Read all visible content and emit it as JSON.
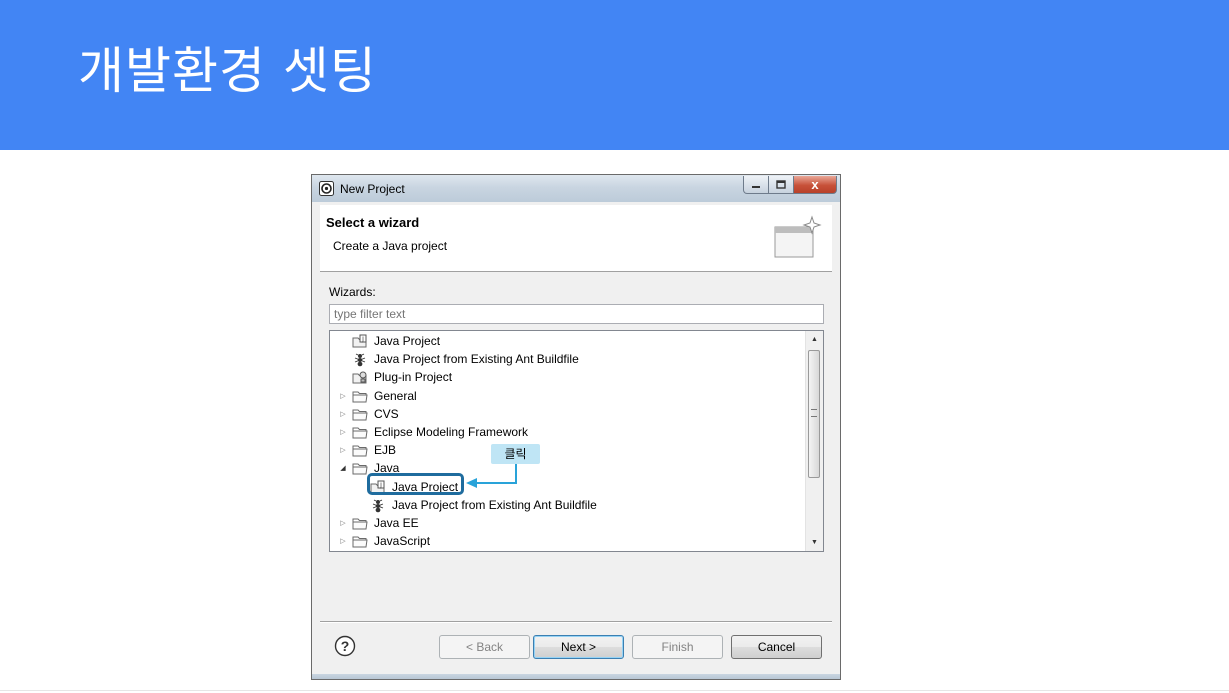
{
  "slide": {
    "title": "개발환경 셋팅"
  },
  "window": {
    "title": "New Project",
    "close_glyph": "x",
    "icons": {
      "app": "eclipse-icon",
      "minimize": "minimize-icon",
      "maximize": "maximize-icon",
      "close": "close-icon"
    }
  },
  "wizard": {
    "title": "Select a wizard",
    "description": "Create a Java project",
    "banner_icon": "new-wizard-icon",
    "wizards_label": "Wizards:",
    "filter_placeholder": "type filter text",
    "tree": [
      {
        "label": "Java Project",
        "icon": "java-project-icon",
        "expanded": null
      },
      {
        "label": "Java Project from Existing Ant Buildfile",
        "icon": "ant-icon",
        "expanded": null
      },
      {
        "label": "Plug-in Project",
        "icon": "plugin-project-icon",
        "expanded": null
      },
      {
        "label": "General",
        "icon": "folder-icon",
        "expanded": false
      },
      {
        "label": "CVS",
        "icon": "folder-icon",
        "expanded": false
      },
      {
        "label": "Eclipse Modeling Framework",
        "icon": "folder-icon",
        "expanded": false
      },
      {
        "label": "EJB",
        "icon": "folder-icon",
        "expanded": false
      },
      {
        "label": "Java",
        "icon": "folder-icon",
        "expanded": true
      },
      {
        "label": "Java Project",
        "icon": "java-project-icon",
        "expanded": null,
        "selected": true
      },
      {
        "label": "Java Project from Existing Ant Buildfile",
        "icon": "ant-icon",
        "expanded": null
      },
      {
        "label": "Java EE",
        "icon": "folder-icon",
        "expanded": false
      },
      {
        "label": "JavaScript",
        "icon": "folder-icon",
        "expanded": false
      }
    ],
    "callout": "클릭",
    "highlight_color": "#1f6c9e",
    "callout_color": "#bfe5f5"
  },
  "buttons": {
    "help_glyph": "?",
    "back": "< Back",
    "next": "Next >",
    "finish": "Finish",
    "cancel": "Cancel"
  },
  "colors": {
    "header": "#4285f4"
  }
}
